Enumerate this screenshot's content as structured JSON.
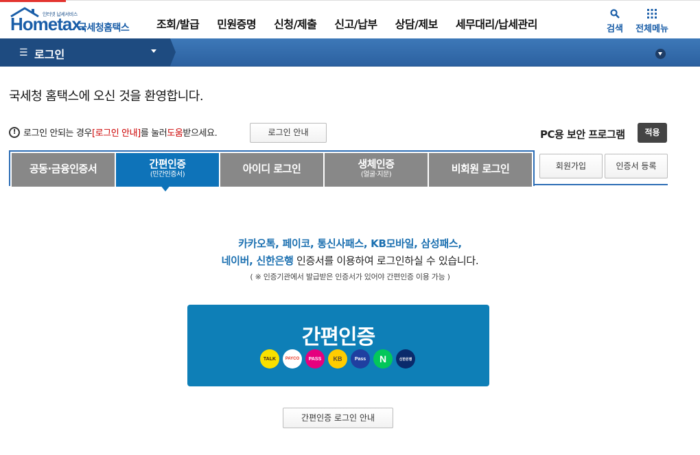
{
  "header": {
    "logo_subtitle": "인터넷 납세서비스",
    "logo_main": "Hometax.",
    "logo_org": "국세청홈택스",
    "nav": [
      "조회/발급",
      "민원증명",
      "신청/제출",
      "신고/납부",
      "상담/제보",
      "세무대리/납세관리"
    ],
    "search_label": "검색",
    "menu_label": "전체메뉴"
  },
  "location": {
    "title": "로그인"
  },
  "welcome": "국세청 홈택스에 오신 것을 환영합니다.",
  "notice": {
    "text_before": "로그인 안되는 경우 ",
    "highlight": "[로그인 안내]",
    "text_middle": "를 눌러 ",
    "help": "도움",
    "text_after": "받으세요.",
    "guide_button": "로그인 안내"
  },
  "pc_security": {
    "label": "PC용 보안 프로그램",
    "apply_button": "적용"
  },
  "tabs": [
    {
      "label": "공동·금융인증서",
      "sub": ""
    },
    {
      "label": "간편인증",
      "sub": "(민간인증서)"
    },
    {
      "label": "아이디 로그인",
      "sub": ""
    },
    {
      "label": "생체인증",
      "sub": "(얼굴·지문)"
    },
    {
      "label": "비회원 로그인",
      "sub": ""
    }
  ],
  "side_buttons": {
    "join": "회원가입",
    "cert_register": "인증서 등록"
  },
  "description": {
    "line1": "카카오톡, 페이코, 통신사패스, KB모바일, 삼성패스,",
    "line2_highlight": "네이버, 신한은행",
    "line2_rest": " 인증서를 이용하여 로그인하실 수 있습니다.",
    "line3": "( ※ 인증기관에서 발급받은 인증서가 있어야 간편인증 이용 가능 )"
  },
  "easy_auth": {
    "label": "간편인증",
    "providers": [
      {
        "name": "kakao-icon",
        "text": "TALK"
      },
      {
        "name": "payco-icon",
        "text": "PAYCO"
      },
      {
        "name": "pass-icon",
        "text": "PASS"
      },
      {
        "name": "kb-icon",
        "text": "KB"
      },
      {
        "name": "samsung-pass-icon",
        "text": "Pass"
      },
      {
        "name": "naver-icon",
        "text": "N"
      },
      {
        "name": "shinhan-icon",
        "text": "신한은행"
      }
    ]
  },
  "bottom_button": "간편인증 로그인 안내",
  "colors": {
    "brand_blue": "#1a5ea8",
    "active_tab": "#0e73b9",
    "inactive_tab": "#888888",
    "alert_red": "#cc0000"
  }
}
